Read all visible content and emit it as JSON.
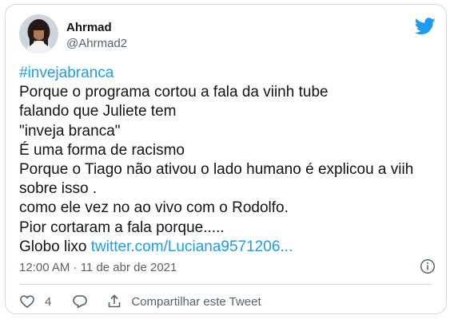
{
  "author": {
    "name": "Ahrmad",
    "handle": "@Ahrmad2",
    "avatar_icon": "avatar-photo"
  },
  "brand": {
    "icon": "twitter-bird-icon",
    "color": "#1d9bf0"
  },
  "tweet": {
    "hashtag": "#invejabranca",
    "lines": [
      "Porque o programa cortou a fala da viinh tube",
      "falando que Juliete tem",
      "\"inveja branca\"",
      "É uma forma de racismo",
      "Porque o Tiago não ativou o lado humano é explicou a viih",
      "sobre isso .",
      "como ele vez no ao vivo com o Rodolfo.",
      "Pior cortaram a fala porque....."
    ],
    "last_line_prefix": "Globo lixo",
    "link_text": "twitter.com/Luciana9571206..."
  },
  "meta": {
    "timestamp": "12:00 AM · 11 de abr de 2021",
    "info_icon": "info-icon"
  },
  "actions": {
    "like_count": "4",
    "share_label": "Compartilhar este Tweet"
  }
}
